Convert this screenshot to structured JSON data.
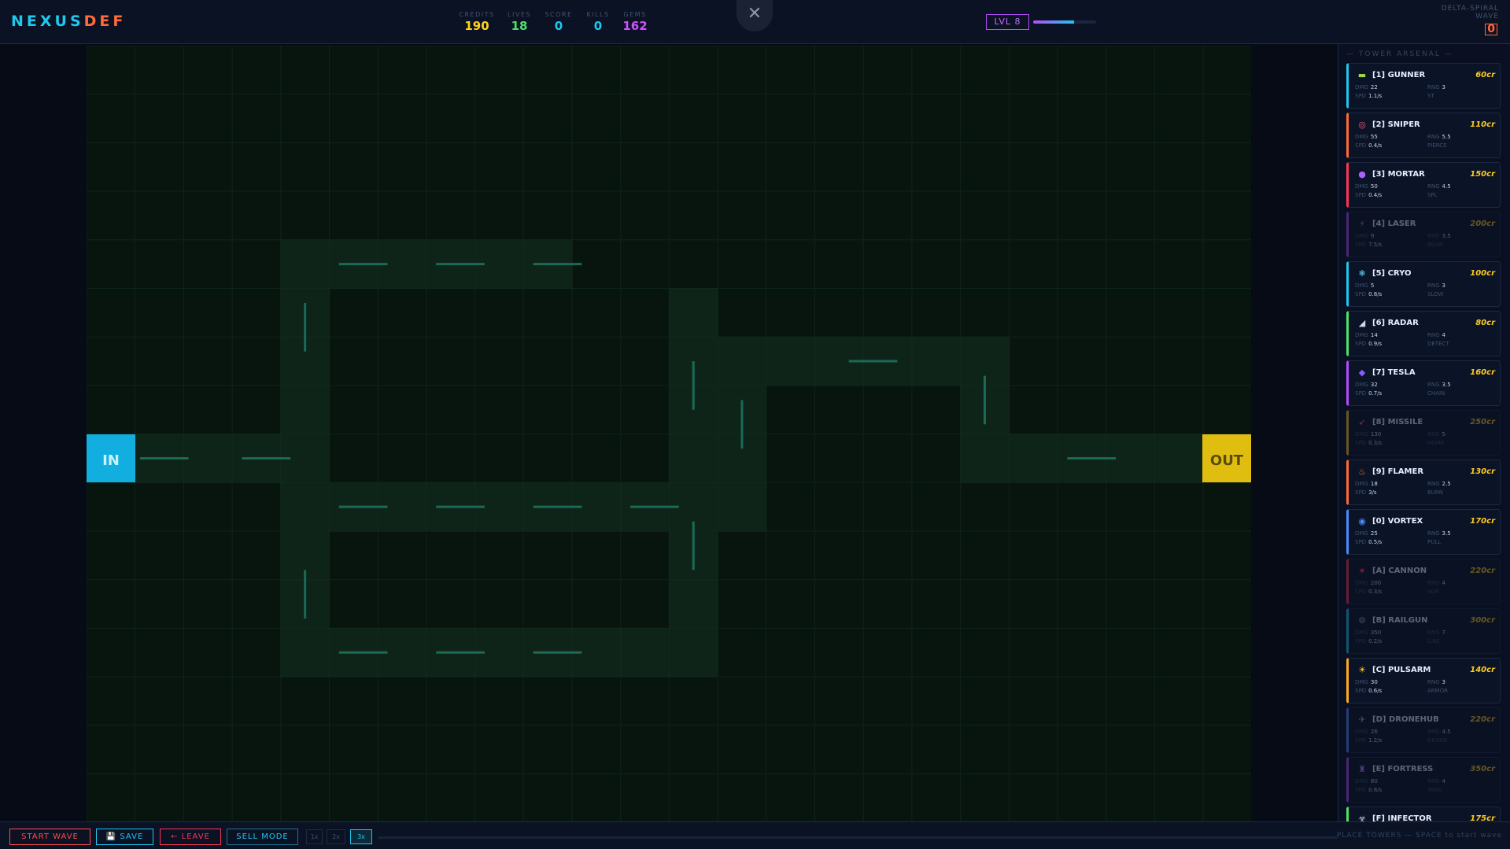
{
  "logo": {
    "part1": "NEXUS",
    "part2": "DEF"
  },
  "stats": [
    {
      "label": "CREDITS",
      "value": "190",
      "color": "#ffd21e"
    },
    {
      "label": "LIVES",
      "value": "18",
      "color": "#4ee06a"
    },
    {
      "label": "SCORE",
      "value": "0",
      "color": "#1ec8ee"
    },
    {
      "label": "KILLS",
      "value": "0",
      "color": "#1ec8ee"
    },
    {
      "label": "GEMS",
      "value": "162",
      "color": "#d050ff"
    }
  ],
  "close_label": "✕",
  "level": {
    "label": "LVL 8",
    "progress": 0.65
  },
  "map": {
    "name_line1": "DELTA-SPIRAL",
    "name_line2": "WAVE",
    "wave": "0"
  },
  "board": {
    "entry_label": "IN",
    "exit_label": "OUT",
    "entry_color": "#12aee0",
    "exit_color": "#e0be10"
  },
  "sidebar": {
    "title": "— TOWER ARSENAL —",
    "towers": [
      {
        "key": "[1]",
        "name": "GUNNER",
        "cost": "60cr",
        "icon": "gun-icon",
        "glyph": "▬",
        "icolor": "#9ad84a",
        "color": "#1ec8ee",
        "dmg": "22",
        "rng": "3",
        "spd": "1.1/s",
        "tag": "ST",
        "locked": false
      },
      {
        "key": "[2]",
        "name": "SNIPER",
        "cost": "110cr",
        "icon": "target-icon",
        "glyph": "◎",
        "icolor": "#ff5577",
        "color": "#ff6a3a",
        "dmg": "55",
        "rng": "5.5",
        "spd": "0.4/s",
        "tag": "PIERCE",
        "locked": false
      },
      {
        "key": "[3]",
        "name": "MORTAR",
        "cost": "150cr",
        "icon": "bomb-icon",
        "glyph": "●",
        "icolor": "#b060ff",
        "color": "#ff3355",
        "dmg": "50",
        "rng": "4.5",
        "spd": "0.4/s",
        "tag": "SPL",
        "locked": false
      },
      {
        "key": "[4]",
        "name": "LASER",
        "cost": "200cr",
        "icon": "bolt-icon",
        "glyph": "⚡",
        "icolor": "#ff8844",
        "color": "#b54bff",
        "dmg": "9",
        "rng": "3.5",
        "spd": "7.5/s",
        "tag": "BEAM",
        "locked": true
      },
      {
        "key": "[5]",
        "name": "CRYO",
        "cost": "100cr",
        "icon": "snowflake-icon",
        "glyph": "❄",
        "icolor": "#66d8ff",
        "color": "#1ec8ee",
        "dmg": "5",
        "rng": "3",
        "spd": "0.8/s",
        "tag": "SLOW",
        "locked": false
      },
      {
        "key": "[6]",
        "name": "RADAR",
        "cost": "80cr",
        "icon": "satellite-icon",
        "glyph": "◢",
        "icolor": "#cfd8e8",
        "color": "#4ee06a",
        "dmg": "14",
        "rng": "4",
        "spd": "0.9/s",
        "tag": "DETECT",
        "locked": false
      },
      {
        "key": "[7]",
        "name": "TESLA",
        "cost": "160cr",
        "icon": "gem-icon",
        "glyph": "◆",
        "icolor": "#8a5cff",
        "color": "#b54bff",
        "dmg": "32",
        "rng": "3.5",
        "spd": "0.7/s",
        "tag": "CHAIN",
        "locked": false
      },
      {
        "key": "[8]",
        "name": "MISSILE",
        "cost": "250cr",
        "icon": "rocket-icon",
        "glyph": "➶",
        "icolor": "#ff7a7a",
        "color": "#ffcc22",
        "dmg": "130",
        "rng": "5",
        "spd": "0.3/s",
        "tag": "HOME",
        "locked": true
      },
      {
        "key": "[9]",
        "name": "FLAMER",
        "cost": "130cr",
        "icon": "flame-icon",
        "glyph": "♨",
        "icolor": "#ff7a22",
        "color": "#ff6a3a",
        "dmg": "18",
        "rng": "2.5",
        "spd": "3/s",
        "tag": "BURN",
        "locked": false
      },
      {
        "key": "[0]",
        "name": "VORTEX",
        "cost": "170cr",
        "icon": "vortex-icon",
        "glyph": "◉",
        "icolor": "#4a8aff",
        "color": "#4a8aff",
        "dmg": "25",
        "rng": "3.5",
        "spd": "0.5/s",
        "tag": "PULL",
        "locked": false
      },
      {
        "key": "[A]",
        "name": "CANNON",
        "cost": "220cr",
        "icon": "blast-icon",
        "glyph": "✷",
        "icolor": "#ff3355",
        "color": "#ff3355",
        "dmg": "200",
        "rng": "4",
        "spd": "0.3/s",
        "tag": "AOE",
        "locked": true
      },
      {
        "key": "[B]",
        "name": "RAILGUN",
        "cost": "300cr",
        "icon": "gear-icon",
        "glyph": "⚙",
        "icolor": "#9aa8c0",
        "color": "#1ec8ee",
        "dmg": "350",
        "rng": "7",
        "spd": "0.2/s",
        "tag": "LINE",
        "locked": true
      },
      {
        "key": "[C]",
        "name": "PULSARM",
        "cost": "140cr",
        "icon": "sun-icon",
        "glyph": "☀",
        "icolor": "#ffcc22",
        "color": "#ffaa22",
        "dmg": "30",
        "rng": "3",
        "spd": "0.6/s",
        "tag": "ARMOR",
        "locked": false
      },
      {
        "key": "[D]",
        "name": "DRONEHUB",
        "cost": "220cr",
        "icon": "drone-icon",
        "glyph": "✈",
        "icolor": "#9aa8c0",
        "color": "#4a8aff",
        "dmg": "26",
        "rng": "4.5",
        "spd": "1.2/s",
        "tag": "DRONE",
        "locked": true
      },
      {
        "key": "[E]",
        "name": "FORTRESS",
        "cost": "350cr",
        "icon": "castle-icon",
        "glyph": "♜",
        "icolor": "#c07aff",
        "color": "#b54bff",
        "dmg": "80",
        "rng": "4",
        "spd": "0.8/s",
        "tag": "TANK",
        "locked": true
      },
      {
        "key": "[F]",
        "name": "INFECTOR",
        "cost": "175cr",
        "icon": "virus-icon",
        "glyph": "☣",
        "icolor": "#cfd8e8",
        "color": "#4ee06a",
        "dmg": "",
        "rng": "",
        "spd": "",
        "tag": "",
        "locked": false
      }
    ]
  },
  "footer": {
    "start_wave": "START WAVE",
    "save": "💾 SAVE",
    "leave": "← LEAVE",
    "sell": "SELL MODE",
    "speeds": [
      "1x",
      "2x",
      "3x"
    ],
    "active_speed": "3x",
    "hint": "PLACE TOWERS — SPACE to start wave"
  }
}
